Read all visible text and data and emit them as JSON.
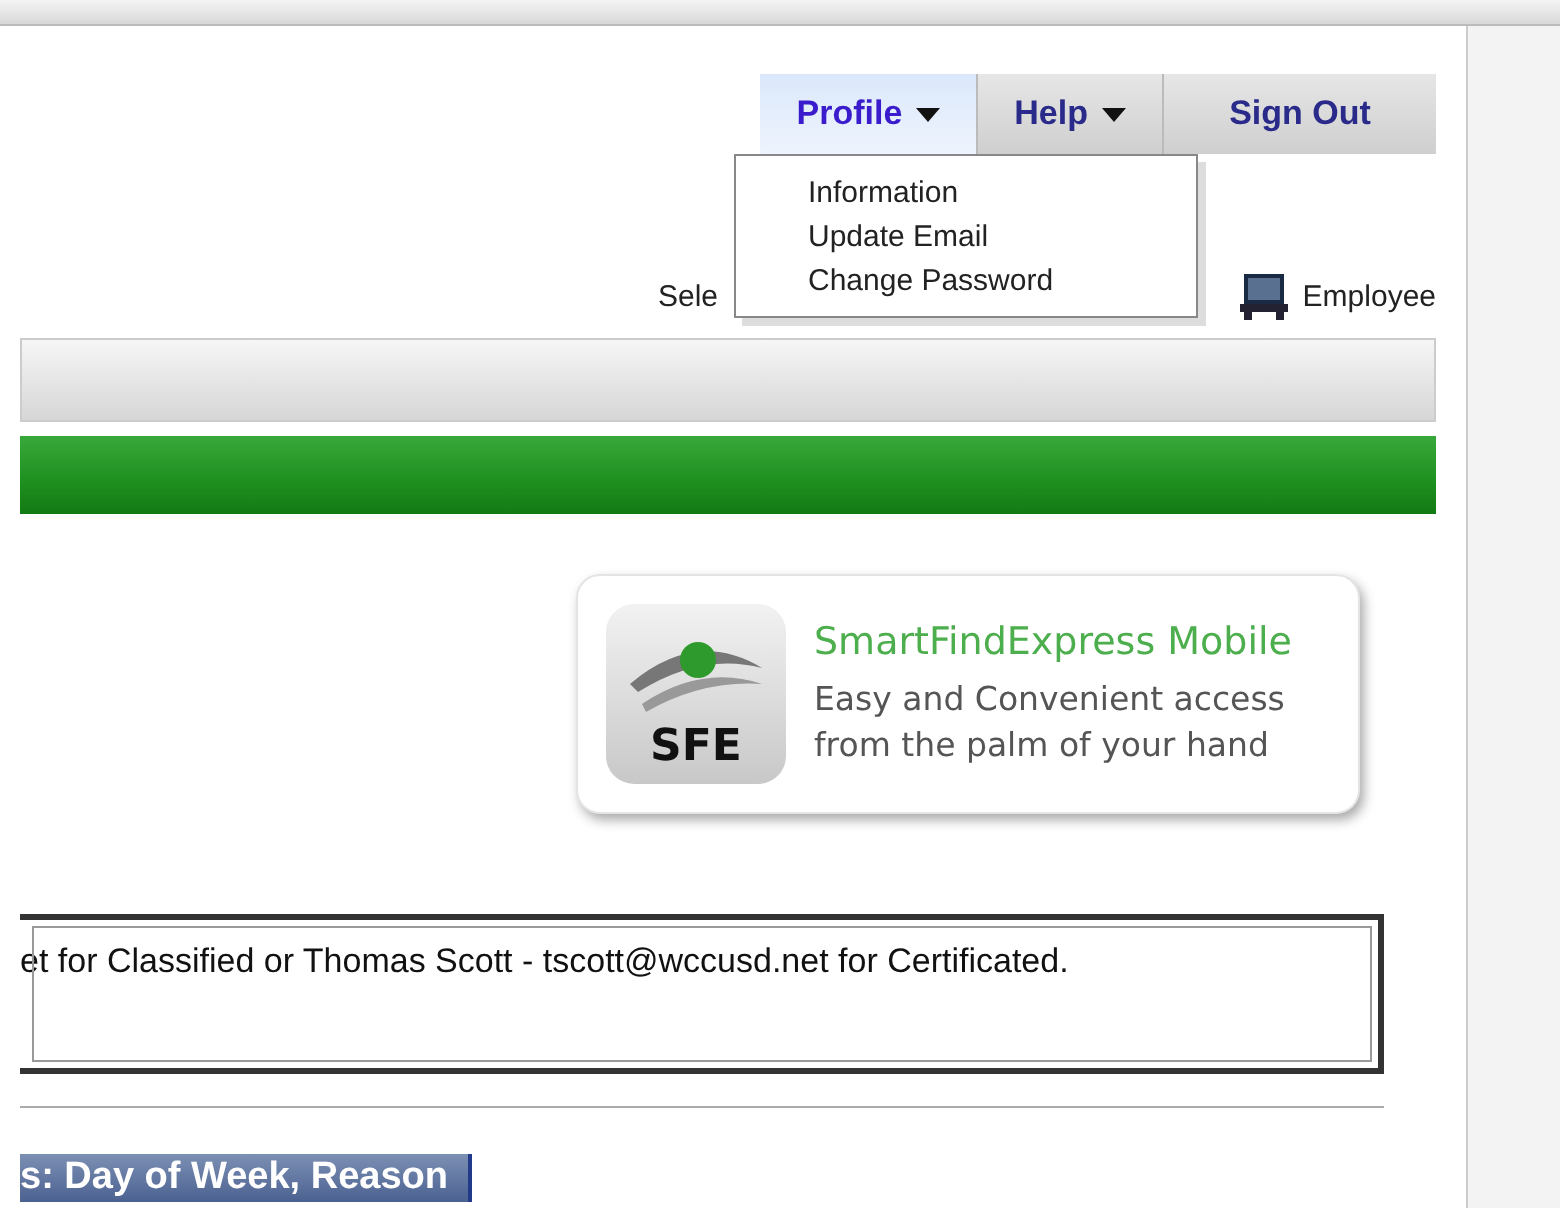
{
  "nav_tabs": [
    {
      "label": "Profile",
      "caret": true,
      "selected": true
    },
    {
      "label": "Help",
      "caret": true,
      "selected": false
    },
    {
      "label": "Sign Out",
      "caret": false,
      "selected": false
    }
  ],
  "profile_menu": [
    "Information",
    "Update Email",
    "Change Password"
  ],
  "role_bar": {
    "select_label": "Sele",
    "role": "Employee"
  },
  "mobile_banner": {
    "logo_text": "SFE",
    "title": "SmartFindExpress Mobile",
    "tagline_lines": [
      "Easy and Convenient access",
      "from the palm of your hand"
    ]
  },
  "notice": "et for Classified or Thomas Scott - tscott@wccusd.net for Certificated.",
  "section_heading": "s: Day of Week, Reason"
}
